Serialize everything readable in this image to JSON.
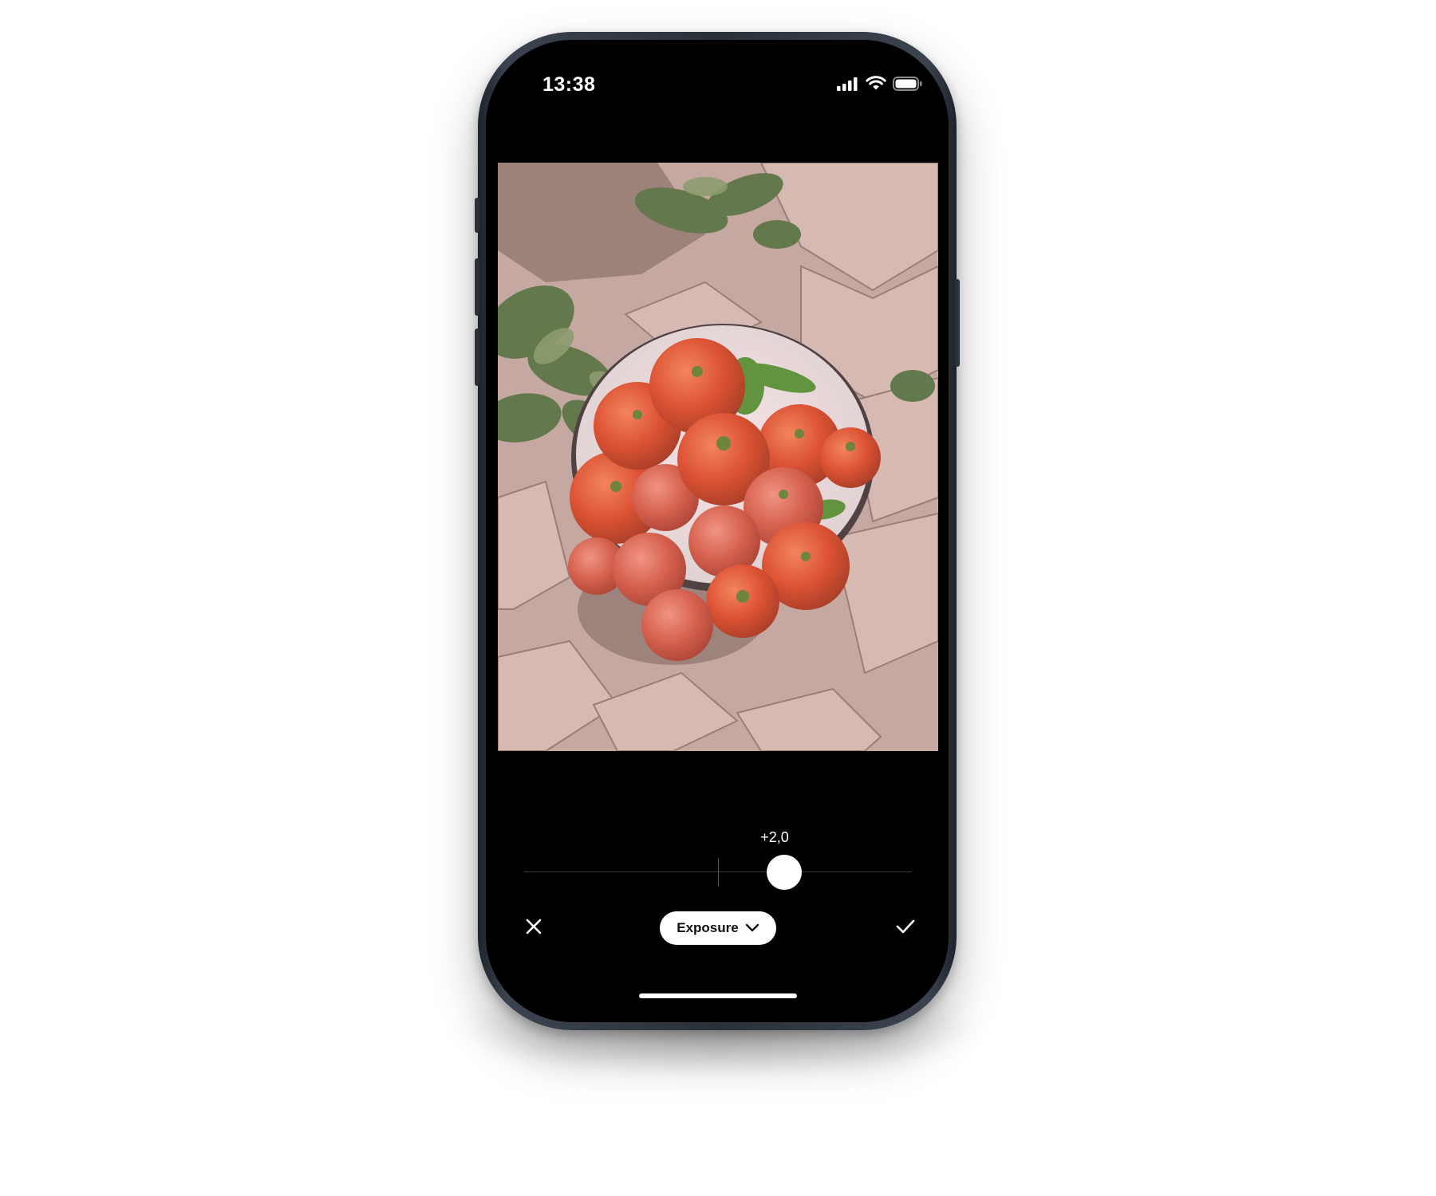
{
  "status_bar": {
    "time": "13:38",
    "icons": [
      "cellular-signal-icon",
      "wifi-icon",
      "battery-icon"
    ]
  },
  "editor": {
    "image_subject": "bowl of tomatoes and green peppers on brick pavement",
    "adjustment": {
      "tool_label": "Exposure",
      "value_label": "+2,0",
      "slider_fraction": 0.67
    },
    "cancel_icon": "close-icon",
    "confirm_icon": "checkmark-icon",
    "dropdown_icon": "chevron-down-icon"
  },
  "colors": {
    "screen_background": "#000000",
    "pill_background": "#ffffff",
    "thumb": "#ffffff"
  }
}
